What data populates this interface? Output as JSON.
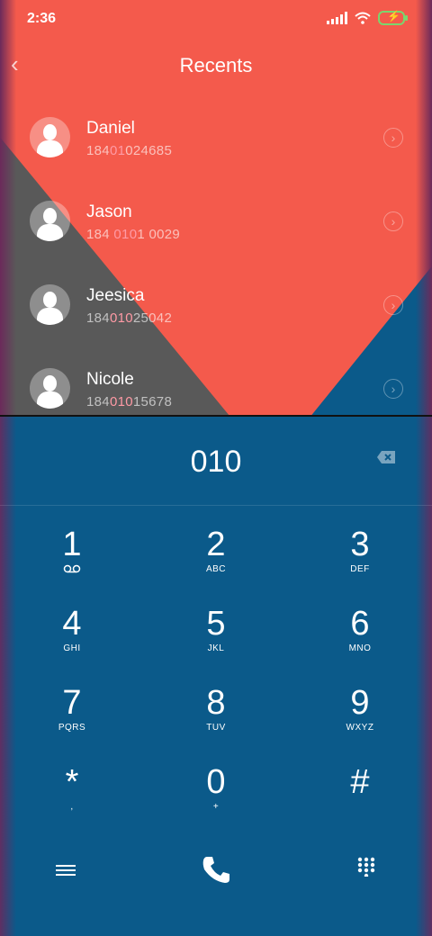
{
  "status": {
    "time": "2:36",
    "battery_color": "#7ad66e"
  },
  "header": {
    "title": "Recents",
    "back_icon": "chevron-left-icon"
  },
  "recents": [
    {
      "name": "Daniel",
      "number_parts": [
        "184",
        "01",
        "024685"
      ]
    },
    {
      "name": "Jason",
      "number_parts": [
        "184 ",
        "010",
        "1 0029"
      ]
    },
    {
      "name": "Jeesica",
      "number_parts": [
        "184",
        "010",
        "25042"
      ]
    },
    {
      "name": "Nicole",
      "number_parts": [
        "184",
        "010",
        "15678"
      ]
    }
  ],
  "dialer": {
    "entered": "010",
    "keys": [
      {
        "digit": "1",
        "letters": ""
      },
      {
        "digit": "2",
        "letters": "ABC"
      },
      {
        "digit": "3",
        "letters": "DEF"
      },
      {
        "digit": "4",
        "letters": "GHI"
      },
      {
        "digit": "5",
        "letters": "JKL"
      },
      {
        "digit": "6",
        "letters": "MNO"
      },
      {
        "digit": "7",
        "letters": "PQRS"
      },
      {
        "digit": "8",
        "letters": "TUV"
      },
      {
        "digit": "9",
        "letters": "WXYZ"
      },
      {
        "digit": "*",
        "letters": ","
      },
      {
        "digit": "0",
        "letters": "+"
      },
      {
        "digit": "#",
        "letters": ""
      }
    ]
  },
  "colors": {
    "accent_red": "#f45a4c",
    "dial_blue": "#0b5a8a",
    "highlight_pink": "#ff9aa5"
  }
}
